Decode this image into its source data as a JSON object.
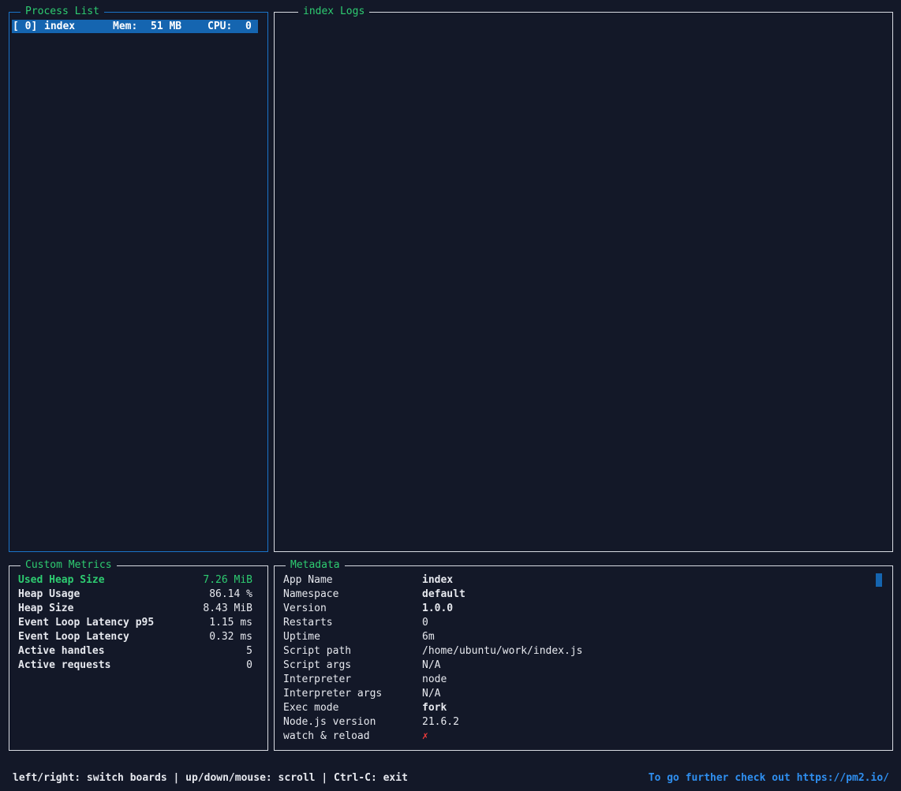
{
  "process_list": {
    "title": "Process List",
    "rows": [
      {
        "id": "[ 0]",
        "name": "index",
        "mem_label": "Mem:",
        "mem_value": "51 MB",
        "cpu_label": "CPU:",
        "cpu_value": "0"
      }
    ]
  },
  "logs": {
    "title": "index Logs"
  },
  "metrics": {
    "title": "Custom Metrics",
    "rows": [
      {
        "label": "Used Heap Size",
        "value": "7.26 MiB"
      },
      {
        "label": "Heap Usage",
        "value": "86.14 %"
      },
      {
        "label": "Heap Size",
        "value": "8.43 MiB"
      },
      {
        "label": "Event Loop Latency p95",
        "value": "1.15 ms"
      },
      {
        "label": "Event Loop Latency",
        "value": "0.32 ms"
      },
      {
        "label": "Active handles",
        "value": "5"
      },
      {
        "label": "Active requests",
        "value": "0"
      }
    ]
  },
  "metadata": {
    "title": "Metadata",
    "rows": [
      {
        "key": "App Name",
        "value": "index"
      },
      {
        "key": "Namespace",
        "value": "default"
      },
      {
        "key": "Version",
        "value": "1.0.0"
      },
      {
        "key": "Restarts",
        "value": "0"
      },
      {
        "key": "Uptime",
        "value": "6m"
      },
      {
        "key": "Script path",
        "value": "/home/ubuntu/work/index.js"
      },
      {
        "key": "Script args",
        "value": "N/A"
      },
      {
        "key": "Interpreter",
        "value": "node"
      },
      {
        "key": "Interpreter args",
        "value": "N/A"
      },
      {
        "key": "Exec mode",
        "value": "fork"
      },
      {
        "key": "Node.js version",
        "value": "21.6.2"
      },
      {
        "key": "watch & reload",
        "value": "✗"
      }
    ]
  },
  "footer": {
    "help": "left/right: switch boards | up/down/mouse: scroll | Ctrl-C: exit",
    "promo": "To go further check out https://pm2.io/"
  },
  "colors": {
    "background": "#131828",
    "accent_green": "#2ecc71",
    "selection_blue": "#1565b0",
    "link_blue": "#2f8ff0",
    "error_red": "#ef3b3b"
  }
}
